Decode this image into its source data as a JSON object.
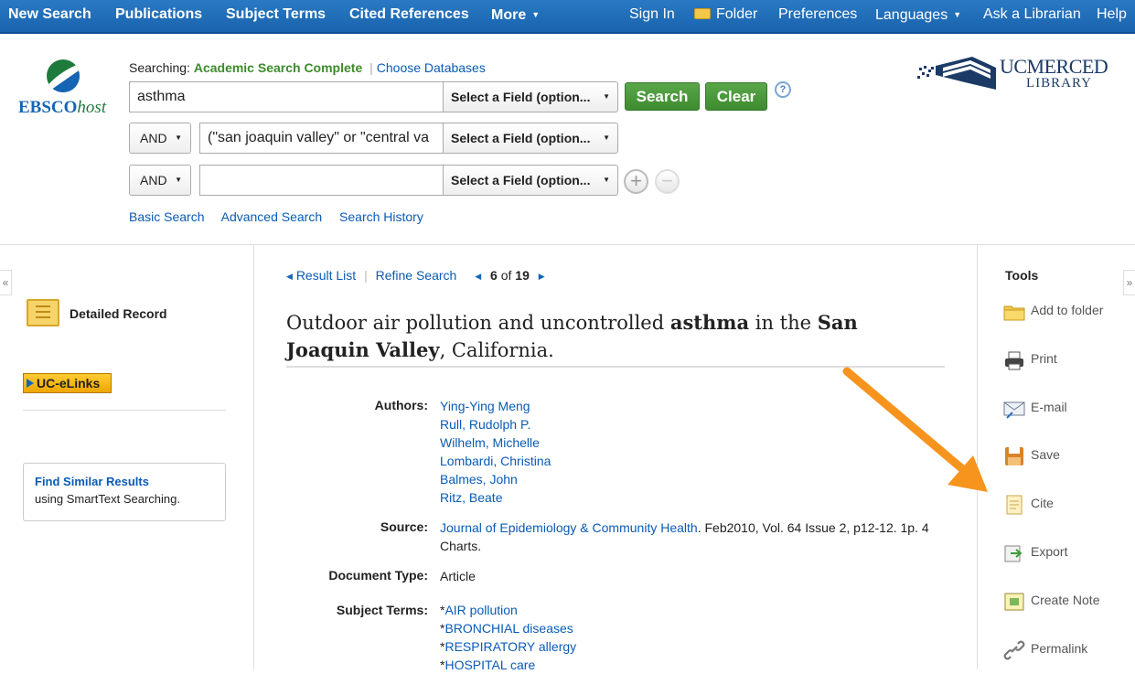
{
  "topnav": {
    "new_search": "New Search",
    "publications": "Publications",
    "subject_terms": "Subject Terms",
    "cited_references": "Cited References",
    "more": "More",
    "sign_in": "Sign In",
    "folder": "Folder",
    "preferences": "Preferences",
    "languages": "Languages",
    "ask_librarian": "Ask a Librarian",
    "help": "Help"
  },
  "logo": {
    "brand": "EBSCO",
    "brand_suffix": "host"
  },
  "library_logo": {
    "name": "UCMERCED",
    "sub": "LIBRARY"
  },
  "search": {
    "searching_label": "Searching:",
    "database": "Academic Search Complete",
    "choose_databases": "Choose Databases",
    "rows": [
      {
        "term": "asthma",
        "field": "Select a Field (option..."
      },
      {
        "bool": "AND",
        "term": "(\"san joaquin valley\" or \"central va",
        "field": "Select a Field (option..."
      },
      {
        "bool": "AND",
        "term": "",
        "field": "Select a Field (option..."
      }
    ],
    "search_button": "Search",
    "clear_button": "Clear",
    "help": "?",
    "basic_search": "Basic Search",
    "advanced_search": "Advanced Search",
    "search_history": "Search History"
  },
  "left": {
    "collapse": "«",
    "detailed_record": "Detailed Record",
    "uc_elinks": "UC-eLinks",
    "similar_title": "Find Similar Results",
    "similar_sub": "using SmartText Searching."
  },
  "nav": {
    "result_list": "Result List",
    "refine_search": "Refine Search",
    "position": "6",
    "of": "of",
    "total": "19"
  },
  "record": {
    "title_parts": [
      "Outdoor air pollution and uncontrolled ",
      "asthma",
      " in the ",
      "San Joaquin Valley",
      ", California."
    ],
    "authors_label": "Authors:",
    "authors": [
      "Ying-Ying Meng",
      "Rull, Rudolph P.",
      "Wilhelm, Michelle",
      "Lombardi, Christina",
      "Balmes, John",
      "Ritz, Beate"
    ],
    "source_label": "Source:",
    "source_journal": "Journal of Epidemiology & Community Health",
    "source_rest": ". Feb2010, Vol. 64 Issue 2, p12-12. 1p. 4",
    "source_rest2": "Charts.",
    "doctype_label": "Document Type:",
    "doctype": "Article",
    "subjects_label": "Subject Terms:",
    "subjects": [
      "AIR pollution",
      "BRONCHIAL diseases",
      "RESPIRATORY allergy",
      "HOSPITAL care"
    ]
  },
  "tools": {
    "title": "Tools",
    "collapse": "»",
    "items": [
      {
        "label": "Add to folder",
        "icon": "folder-icon"
      },
      {
        "label": "Print",
        "icon": "printer-icon"
      },
      {
        "label": "E-mail",
        "icon": "email-icon"
      },
      {
        "label": "Save",
        "icon": "save-disk-icon"
      },
      {
        "label": "Cite",
        "icon": "cite-icon"
      },
      {
        "label": "Export",
        "icon": "export-icon"
      },
      {
        "label": "Create Note",
        "icon": "note-icon"
      },
      {
        "label": "Permalink",
        "icon": "link-icon"
      }
    ]
  },
  "colors": {
    "nav_blue": "#1a63ad",
    "green": "#3e8a30",
    "link": "#0a5bb5",
    "arrow": "#f7941d"
  }
}
